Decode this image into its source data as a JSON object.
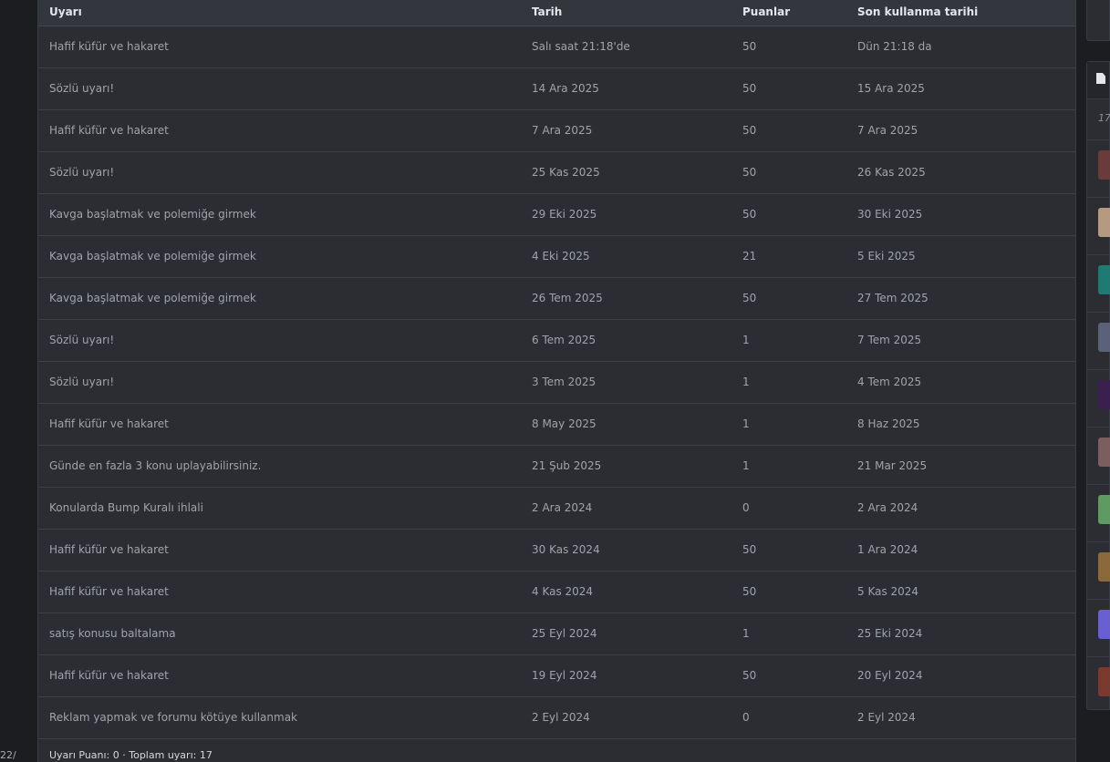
{
  "table": {
    "headers": [
      "Uyarı",
      "Tarih",
      "Puanlar",
      "Son kullanma tarihi"
    ],
    "rows": [
      [
        "Hafif küfür ve hakaret",
        "Salı saat 21:18'de",
        "50",
        "Dün 21:18 da"
      ],
      [
        "Sözlü uyarı!",
        "14 Ara 2025",
        "50",
        "15 Ara 2025"
      ],
      [
        "Hafif küfür ve hakaret",
        "7 Ara 2025",
        "50",
        "7 Ara 2025"
      ],
      [
        "Sözlü uyarı!",
        "25 Kas 2025",
        "50",
        "26 Kas 2025"
      ],
      [
        "Kavga başlatmak ve polemiğe girmek",
        "29 Eki 2025",
        "50",
        "30 Eki 2025"
      ],
      [
        "Kavga başlatmak ve polemiğe girmek",
        "4 Eki 2025",
        "21",
        "5 Eki 2025"
      ],
      [
        "Kavga başlatmak ve polemiğe girmek",
        "26 Tem 2025",
        "50",
        "27 Tem 2025"
      ],
      [
        "Sözlü uyarı!",
        "6 Tem 2025",
        "1",
        "7 Tem 2025"
      ],
      [
        "Sözlü uyarı!",
        "3 Tem 2025",
        "1",
        "4 Tem 2025"
      ],
      [
        "Hafif küfür ve hakaret",
        "8 May 2025",
        "1",
        "8 Haz 2025"
      ],
      [
        "Günde en fazla 3 konu uplayabilirsiniz.",
        "21 Şub 2025",
        "1",
        "21 Mar 2025"
      ],
      [
        "Konularda Bump Kuralı ihlali",
        "2 Ara 2024",
        "0",
        "2 Ara 2024"
      ],
      [
        "Hafif küfür ve hakaret",
        "30 Kas 2024",
        "50",
        "1 Ara 2024"
      ],
      [
        "Hafif küfür ve hakaret",
        "4 Kas 2024",
        "50",
        "5 Kas 2024"
      ],
      [
        "satış konusu baltalama",
        "25 Eyl 2024",
        "1",
        "25 Eki 2024"
      ],
      [
        "Hafif küfür ve hakaret",
        "19 Eyl 2024",
        "50",
        "20 Eyl 2024"
      ],
      [
        "Reklam yapmak ve forumu kötüye kullanmak",
        "2 Eyl 2024",
        "0",
        "2 Eyl 2024"
      ]
    ]
  },
  "footer": {
    "summary": "Uyarı Puanı: 0 · Toplam uyarı: 17"
  },
  "left_gutter": {
    "text": "22/"
  },
  "right_sidebar": {
    "count_partial": "17",
    "header_icon": "document-icon",
    "avatar_colors": [
      "#6b3a3a",
      "#b59a82",
      "#1f7a73",
      "#5b6178",
      "#3a1f4f",
      "#7a5e60",
      "#5e9a62",
      "#8a6a3a",
      "#6a5fd0",
      "#7a3a2f"
    ]
  },
  "colors": {
    "panel_bg": "#2b2d33",
    "header_bg": "#34363e",
    "page_bg": "#1c1d21",
    "text_muted": "#9fa3ab",
    "text_bright": "#e4e6ea"
  }
}
